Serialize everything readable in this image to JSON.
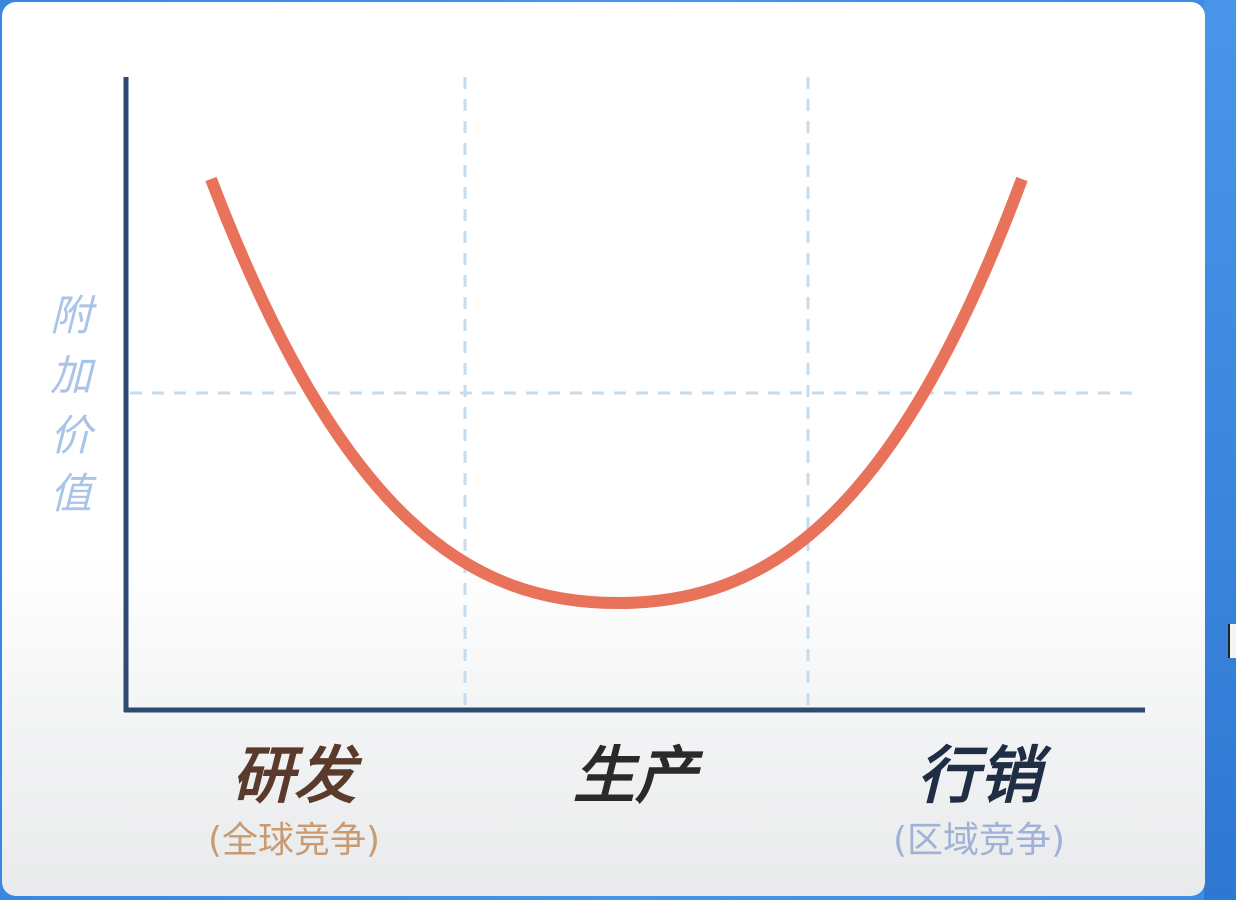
{
  "diagram": {
    "type": "smile-curve",
    "y_axis_label": [
      "附",
      "加",
      "价",
      "值"
    ],
    "stages": [
      {
        "label": "研发",
        "sublabel": "(全球竞争)",
        "color": "#5a3a2a",
        "sub_color": "#c99b72"
      },
      {
        "label": "生产",
        "sublabel": "",
        "color": "#2a2a2a",
        "sub_color": "#9aa9c4"
      },
      {
        "label": "行销",
        "sublabel": "(区域竞争)",
        "color": "#1f2e45",
        "sub_color": "#9fb2d6"
      }
    ],
    "colors": {
      "axis": "#2e4a72",
      "curve": "#e8735a",
      "gridline": "#c5dcef",
      "y_label": "#a9c4e6"
    }
  }
}
